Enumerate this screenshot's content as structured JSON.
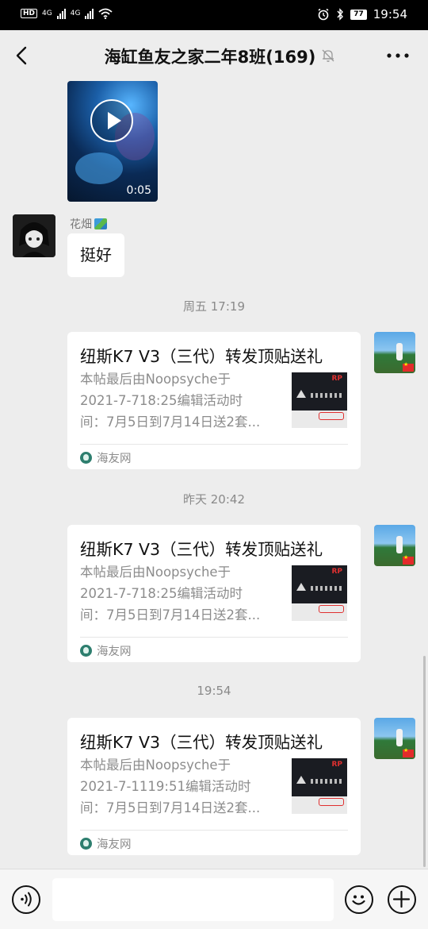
{
  "status_bar": {
    "network_left": "HD",
    "signal1_label": "4G",
    "signal2_label": "4G",
    "battery": "77",
    "time": "19:54"
  },
  "header": {
    "title": "海缸鱼友之家二年8班(169)"
  },
  "messages": {
    "video": {
      "duration": "0:05"
    },
    "text_message": {
      "sender": "花畑",
      "text": "挺好"
    },
    "timestamps": [
      "周五 17:19",
      "昨天 20:42",
      "19:54"
    ],
    "cards": [
      {
        "title": "纽斯K7 V3（三代）转发顶贴送礼",
        "desc_lines": [
          "本帖最后由Noopsyche于",
          "2021-7-718:25编辑活动时",
          "间：7月5日到7月14日送2套..."
        ],
        "source": "海友网",
        "thumb_logo": "RP"
      },
      {
        "title": "纽斯K7 V3（三代）转发顶贴送礼",
        "desc_lines": [
          "本帖最后由Noopsyche于",
          "2021-7-718:25编辑活动时",
          "间：7月5日到7月14日送2套..."
        ],
        "source": "海友网",
        "thumb_logo": "RP"
      },
      {
        "title": "纽斯K7 V3（三代）转发顶贴送礼",
        "desc_lines": [
          "本帖最后由Noopsyche于",
          "2021-7-1119:51编辑活动时",
          "间：7月5日到7月14日送2套..."
        ],
        "source": "海友网",
        "thumb_logo": "RP"
      }
    ]
  },
  "input_bar": {
    "placeholder": ""
  },
  "icons": {
    "back": "back-arrow-icon",
    "mute": "mute-bell-icon",
    "more": "more-dots-icon",
    "voice": "voice-icon",
    "emoji": "emoji-icon",
    "plus": "plus-icon"
  }
}
